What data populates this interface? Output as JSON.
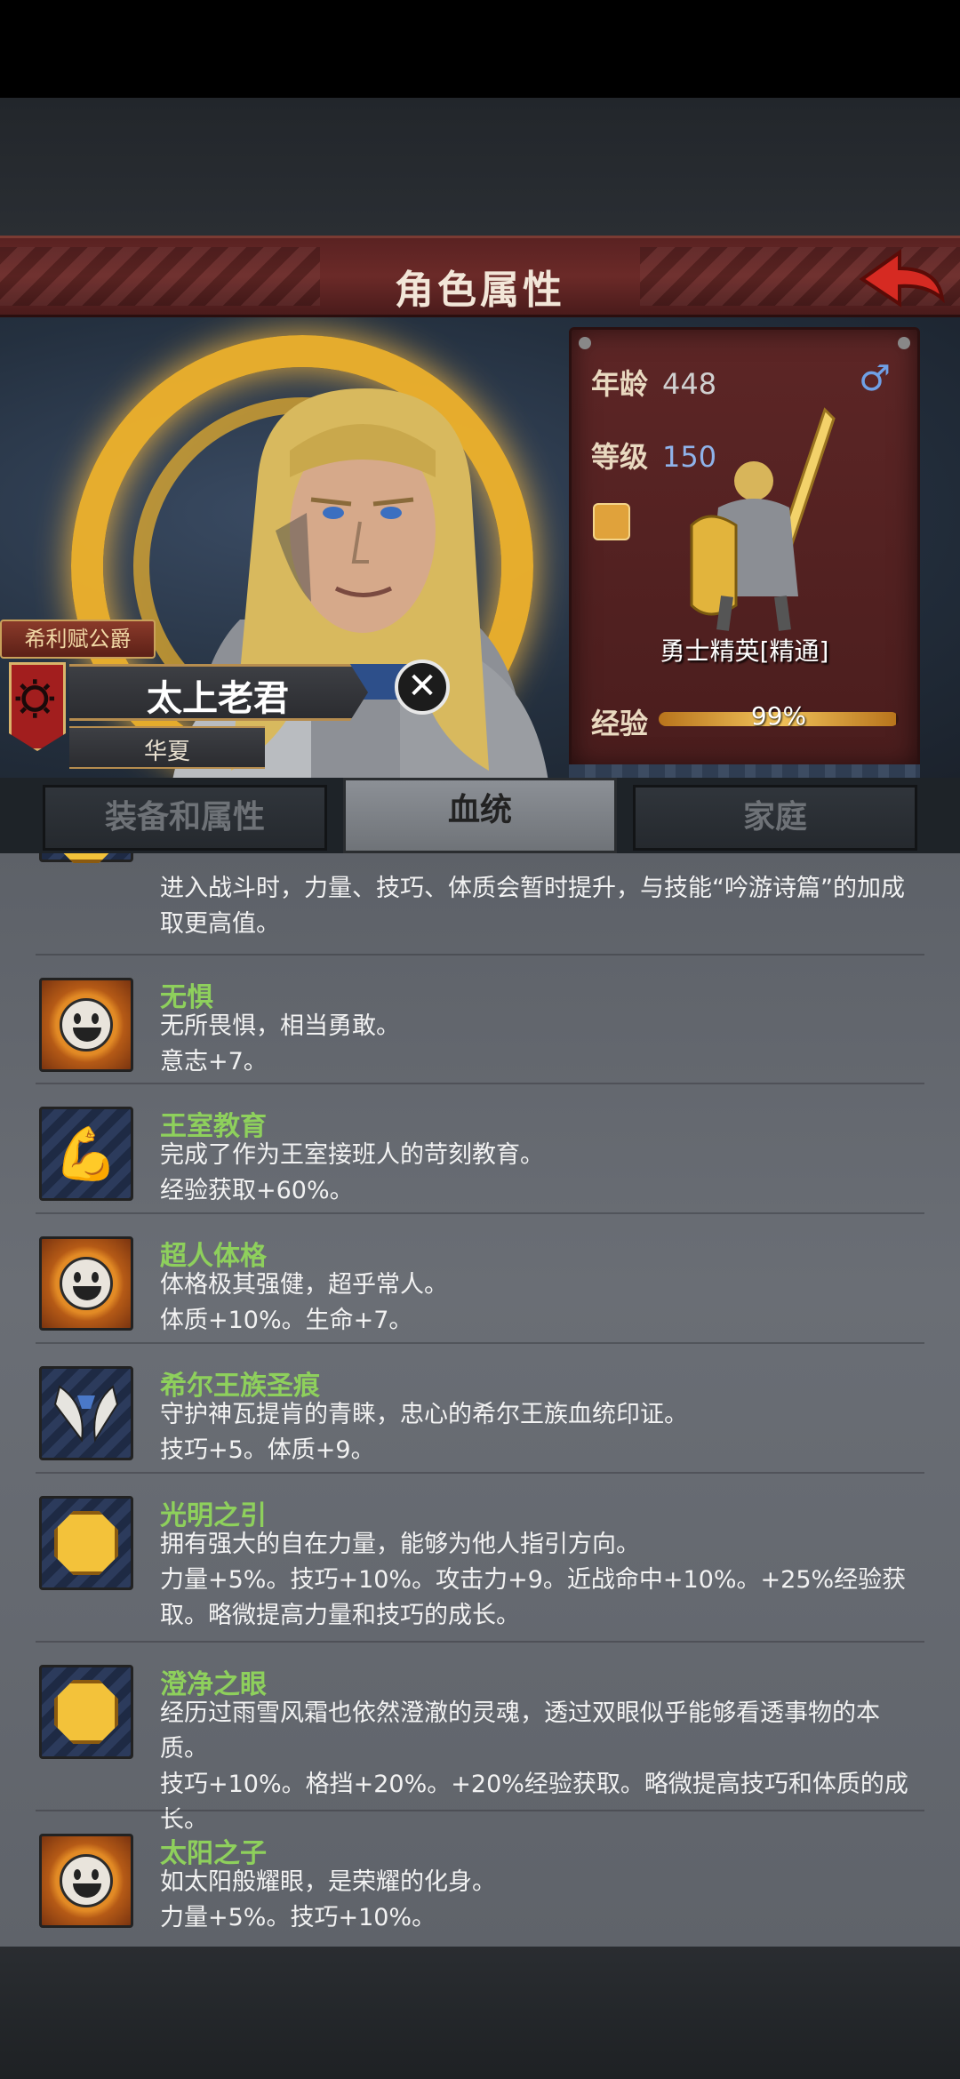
{
  "header": {
    "title": "角色属性"
  },
  "character": {
    "title_tag": "希利赋公爵",
    "name": "太上老君",
    "origin": "华夏"
  },
  "stats": {
    "age_label": "年龄",
    "age": "448",
    "level_label": "等级",
    "level": "150",
    "gender": "♂",
    "class_name": "勇士精英[精通]",
    "exp_label": "经验",
    "exp_percent": "99%",
    "exp_fraction": 0.99
  },
  "tabs": [
    {
      "label": "装备和属性",
      "active": false
    },
    {
      "label": "血统",
      "active": true
    },
    {
      "label": "家庭",
      "active": false
    }
  ],
  "partial_trait": {
    "desc": "进入战斗时，力量、技巧、体质会暂时提升，与技能“吟游诗篇”的加成取更高值。"
  },
  "traits": [
    {
      "icon": "smiley-icon",
      "name": "无惧",
      "desc": "无所畏惧，相当勇敢。",
      "effect": "意志+7。"
    },
    {
      "icon": "flexed-arm-icon",
      "name": "王室教育",
      "desc": "完成了作为王室接班人的苛刻教育。",
      "effect": "经验获取+60%。"
    },
    {
      "icon": "smiley-icon",
      "name": "超人体格",
      "desc": "体格极其强健，超乎常人。",
      "effect": "体质+10%。生命+7。"
    },
    {
      "icon": "wing-crest-icon",
      "name": "希尔王族圣痕",
      "desc": "守护神瓦提肯的青睐，忠心的希尔王族血统印证。",
      "effect": "技巧+5。体质+9。"
    },
    {
      "icon": "gold-coin-icon",
      "name": "光明之引",
      "desc": "拥有强大的自在力量，能够为他人指引方向。",
      "effect": "力量+5%。技巧+10%。攻击力+9。近战命中+10%。+25%经验获取。略微提高力量和技巧的成长。"
    },
    {
      "icon": "gold-coin-icon",
      "name": "澄净之眼",
      "desc": "经历过雨雪风霜也依然澄澈的灵魂，透过双眼似乎能够看透事物的本质。",
      "effect": "技巧+10%。格挡+20%。+20%经验获取。略微提高技巧和体质的成长。"
    },
    {
      "icon": "smiley-icon",
      "name": "太阳之子",
      "desc": "如太阳般耀眼，是荣耀的化身。",
      "effect": "力量+5%。技巧+10%。"
    }
  ],
  "colors": {
    "accent_green": "#8ed05c",
    "title_red": "#6b2a28",
    "halo_gold": "#f0b32c"
  }
}
